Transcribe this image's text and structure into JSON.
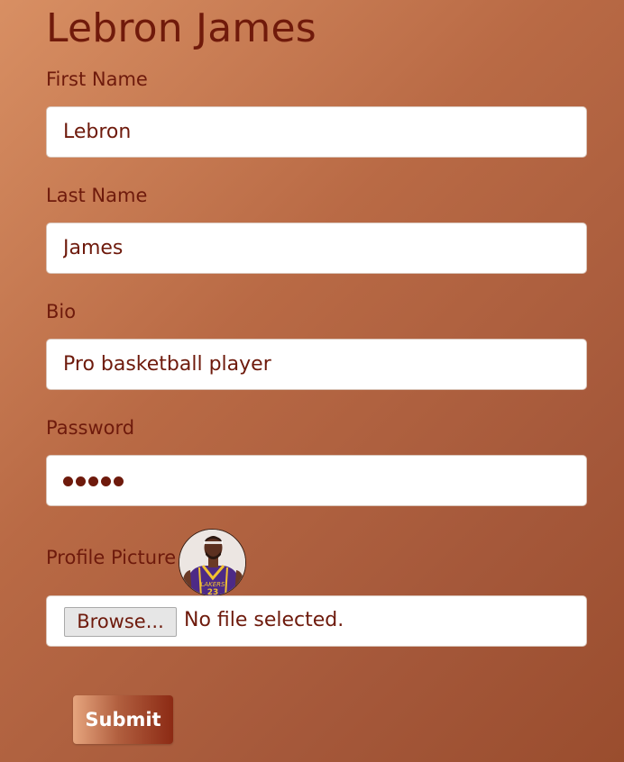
{
  "page": {
    "title": "Lebron James"
  },
  "form": {
    "first_name": {
      "label": "First Name",
      "value": "Lebron"
    },
    "last_name": {
      "label": "Last Name",
      "value": "James"
    },
    "bio": {
      "label": "Bio",
      "value": "Pro basketball player"
    },
    "password": {
      "label": "Password",
      "masked_length": 5
    },
    "profile_picture": {
      "label": "Profile Picture",
      "browse_label": "Browse...",
      "file_status": "No file selected."
    },
    "submit_label": "Submit"
  },
  "colors": {
    "text": "#6e1a0c",
    "background_start": "#d88f63",
    "background_end": "#9a4d2e"
  }
}
